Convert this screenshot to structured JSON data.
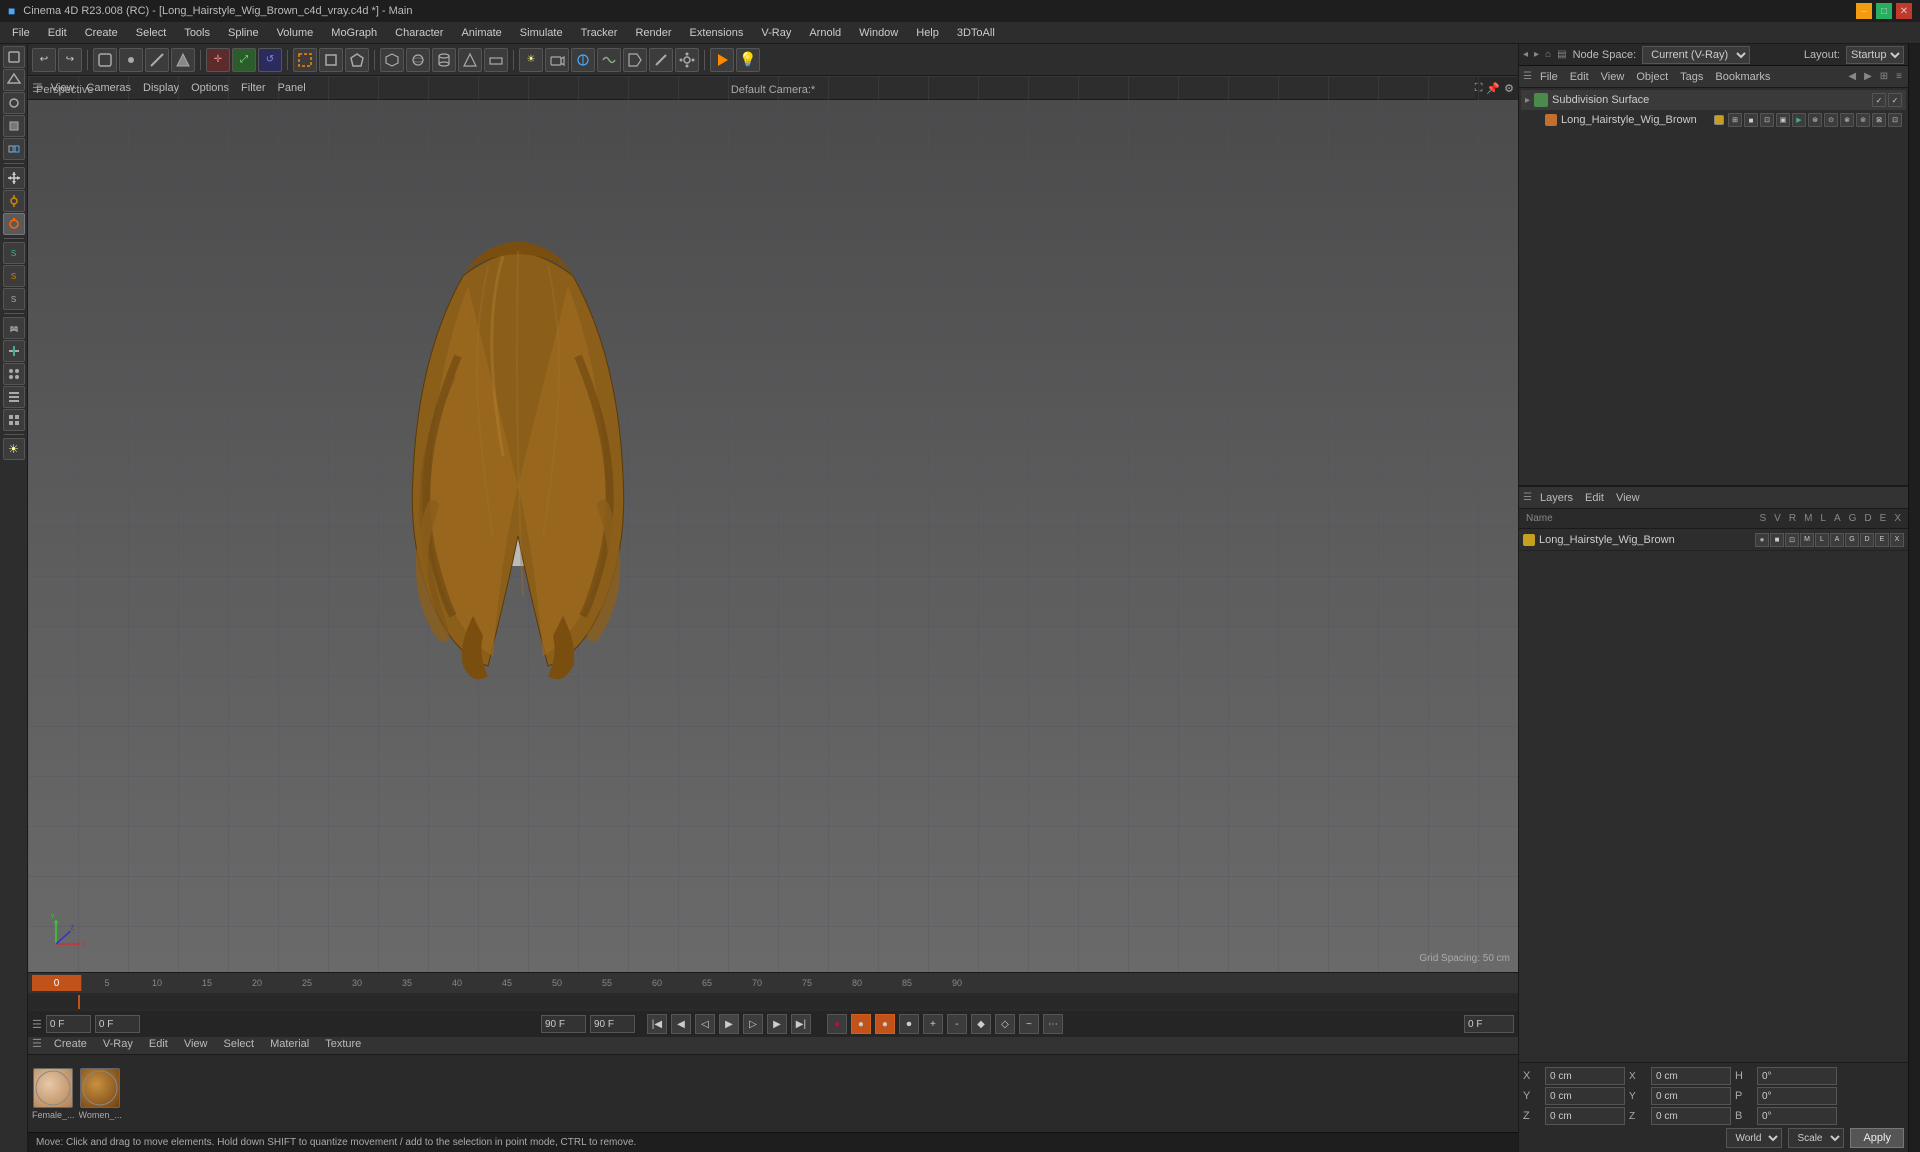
{
  "titlebar": {
    "title": "Cinema 4D R23.008 (RC) - [Long_Hairstyle_Wig_Brown_c4d_vray.c4d *] - Main",
    "min_label": "–",
    "max_label": "□",
    "close_label": "✕"
  },
  "menubar": {
    "items": [
      "File",
      "Edit",
      "Create",
      "Select",
      "Tools",
      "Spline",
      "Volume",
      "MoGraph",
      "Character",
      "Animate",
      "Simulate",
      "Tracker",
      "Render",
      "Extensions",
      "V-Ray",
      "Arnold",
      "Window",
      "Help",
      "3DToAll"
    ]
  },
  "top_toolbar": {
    "node_space_label": "Node Space:",
    "node_space_value": "Current (V-Ray)",
    "layout_label": "Layout:",
    "layout_value": "Startup"
  },
  "viewport": {
    "perspective": "Perspective",
    "camera": "Default Camera:*",
    "grid_spacing": "Grid Spacing: 50 cm",
    "menu_items": [
      "View",
      "Cameras",
      "Display",
      "Options",
      "Filter",
      "Panel"
    ]
  },
  "timeline": {
    "ticks": [
      "0",
      "5",
      "10",
      "15",
      "20",
      "25",
      "30",
      "35",
      "40",
      "45",
      "50",
      "55",
      "60",
      "65",
      "70",
      "75",
      "80",
      "85",
      "90"
    ],
    "current_frame": "0 F",
    "start_frame": "0 F",
    "end_frame": "90 F",
    "end_frame2": "90 F",
    "frame_indicator": "0 F"
  },
  "material_editor": {
    "menu_items": [
      "Create",
      "V-Ray",
      "Edit",
      "View",
      "Select",
      "Material",
      "Texture"
    ],
    "materials": [
      {
        "name": "Female_..."
      },
      {
        "name": "Women_..."
      }
    ]
  },
  "status_bar": {
    "text": "Move: Click and drag to move elements. Hold down SHIFT to quantize movement / add to the selection in point mode, CTRL to remove."
  },
  "object_manager": {
    "menu_items": [
      "File",
      "Edit",
      "View",
      "Object",
      "Tags",
      "Bookmarks"
    ],
    "objects": [
      {
        "name": "Subdivision Surface",
        "icon": "green",
        "has_checkmark": true
      },
      {
        "name": "Long_Hairstyle_Wig_Brown",
        "icon": "orange",
        "indent": 16
      }
    ]
  },
  "layers_panel": {
    "menu_items": [
      "Layers",
      "Edit",
      "View"
    ],
    "columns": [
      "Name",
      "S",
      "V",
      "R",
      "M",
      "L",
      "A",
      "G",
      "D",
      "E",
      "X"
    ],
    "layers": [
      {
        "name": "Long_Hairstyle_Wig_Brown",
        "color": "#c8a020"
      }
    ]
  },
  "coord_panel": {
    "x_label": "X",
    "y_label": "Y",
    "z_label": "Z",
    "h_label": "H",
    "p_label": "P",
    "b_label": "B",
    "x_pos": "0 cm",
    "y_pos": "0 cm",
    "z_pos": "0 cm",
    "x_rot": "0°",
    "y_rot": "0°",
    "z_rot": "0°",
    "x2_label": "X",
    "y2_label": "Y",
    "z2_label": "Z",
    "x2_val": "0 cm",
    "y2_val": "0 cm",
    "z2_val": "0 cm",
    "world_label": "World",
    "scale_label": "Scale",
    "apply_label": "Apply"
  },
  "icons": {
    "hamburger": "☰",
    "undo": "↩",
    "redo": "↪",
    "move": "✛",
    "rotate": "↺",
    "scale": "⤢",
    "play": "▶",
    "stop": "■",
    "prev": "◀◀",
    "next": "▶▶",
    "first": "|◀",
    "last": "▶|",
    "record": "●",
    "eye": "👁",
    "lock": "🔒",
    "expand": "⛶",
    "chevron_down": "▾",
    "chevron_right": "▸",
    "x_axis": "X",
    "y_axis": "Y",
    "z_axis": "Z"
  }
}
